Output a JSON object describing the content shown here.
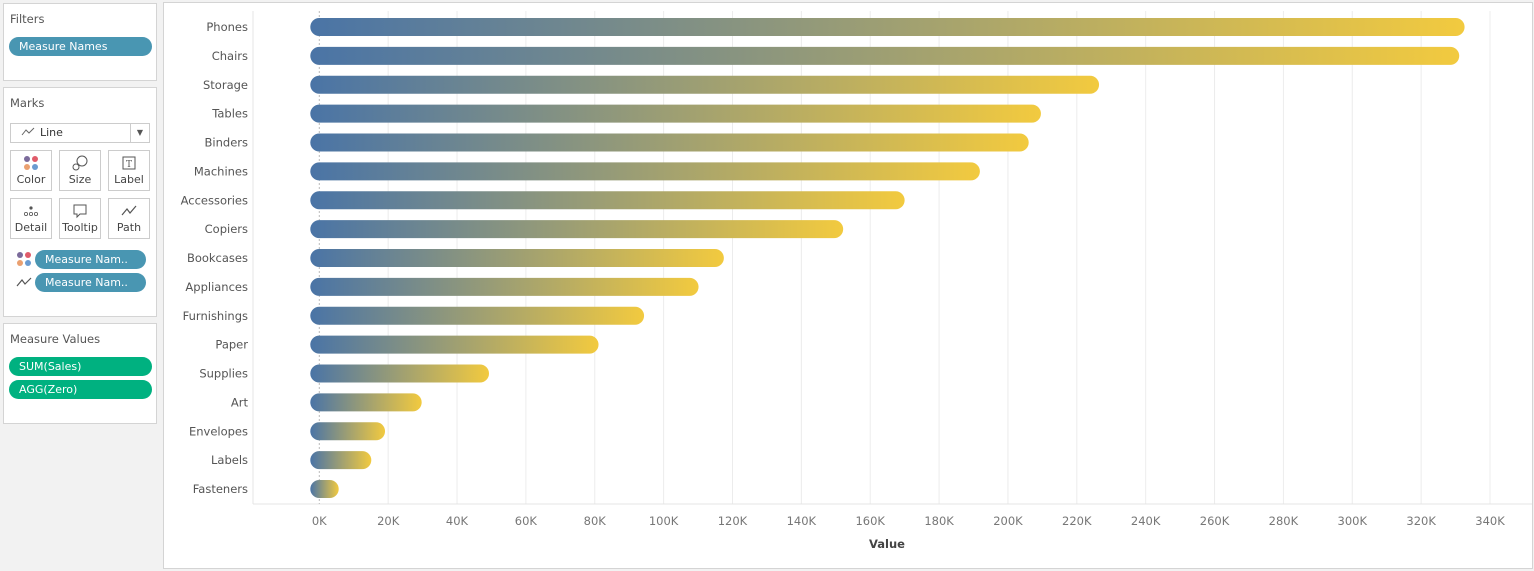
{
  "filters": {
    "title": "Filters",
    "pills": [
      "Measure Names"
    ]
  },
  "marks": {
    "title": "Marks",
    "mark_type": "Line",
    "buttons": [
      "Color",
      "Size",
      "Label",
      "Detail",
      "Tooltip",
      "Path"
    ],
    "pills": [
      {
        "icon": "color-icon",
        "label": "Measure Nam.."
      },
      {
        "icon": "path-icon",
        "label": "Measure Nam.."
      }
    ]
  },
  "measure_values": {
    "title": "Measure Values",
    "pills": [
      "SUM(Sales)",
      "AGG(Zero)"
    ]
  },
  "colors": {
    "start": "#4a74a6",
    "end": "#f2ca3f",
    "blue_pill": "#4996b2",
    "green_pill": "#00b180"
  },
  "chart_data": {
    "type": "bar",
    "orientation": "horizontal",
    "xlabel": "Value",
    "ylabel": "",
    "xlim": [
      0,
      340000
    ],
    "ticks": [
      "0K",
      "20K",
      "40K",
      "60K",
      "80K",
      "100K",
      "120K",
      "140K",
      "160K",
      "180K",
      "200K",
      "220K",
      "240K",
      "260K",
      "280K",
      "300K",
      "320K",
      "340K"
    ],
    "tick_values": [
      0,
      20000,
      40000,
      60000,
      80000,
      100000,
      120000,
      140000,
      160000,
      180000,
      200000,
      220000,
      240000,
      260000,
      280000,
      300000,
      320000,
      340000
    ],
    "grid": true,
    "categories": [
      "Phones",
      "Chairs",
      "Storage",
      "Tables",
      "Binders",
      "Machines",
      "Accessories",
      "Copiers",
      "Bookcases",
      "Appliances",
      "Furnishings",
      "Paper",
      "Supplies",
      "Art",
      "Envelopes",
      "Labels",
      "Fasteners"
    ],
    "values": [
      330007,
      328449,
      223844,
      206966,
      203413,
      189239,
      167380,
      149528,
      114880,
      107532,
      91705,
      78479,
      46674,
      27119,
      16476,
      12486,
      3024
    ]
  }
}
